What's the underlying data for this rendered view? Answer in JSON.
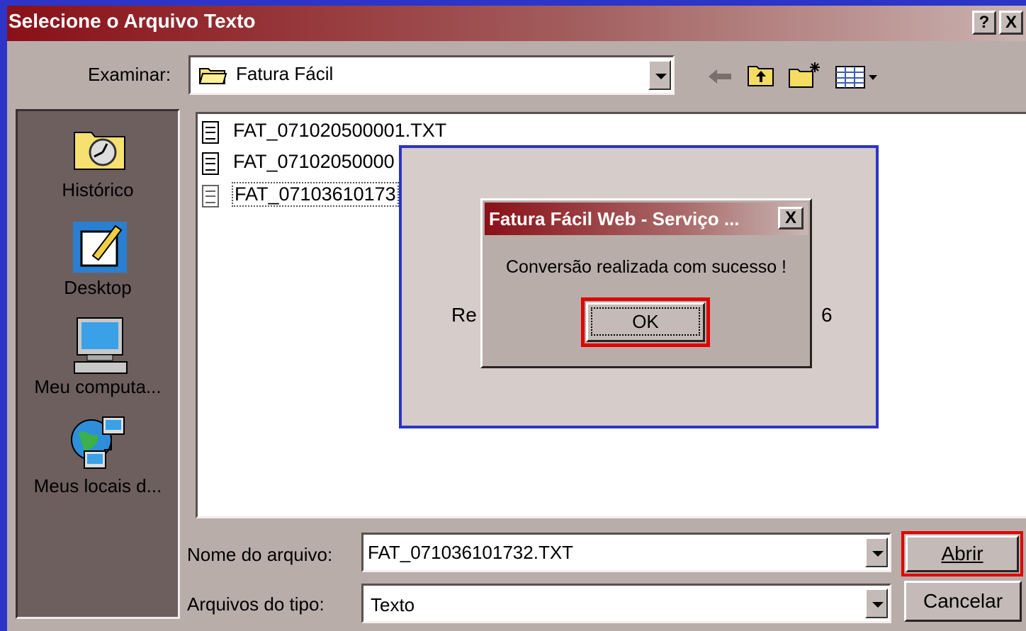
{
  "window": {
    "title": "Selecione o Arquivo Texto",
    "help_label": "?",
    "close_label": "X"
  },
  "toolbar": {
    "look_in_label": "Examinar:",
    "look_in_value": "Fatura Fácil"
  },
  "places": [
    {
      "label": "Histórico",
      "icon": "history-icon"
    },
    {
      "label": "Desktop",
      "icon": "desktop-icon"
    },
    {
      "label": "Meu computa...",
      "icon": "my-computer-icon"
    },
    {
      "label": "Meus locais d...",
      "icon": "network-places-icon"
    }
  ],
  "files": [
    {
      "name": "FAT_071020500001.TXT"
    },
    {
      "name": "FAT_07102050000"
    },
    {
      "name": "FAT_07103610173"
    }
  ],
  "form": {
    "filename_label": "Nome do arquivo:",
    "filename_value": "FAT_071036101732.TXT",
    "filetype_label": "Arquivos do tipo:",
    "filetype_value": "Texto",
    "open_label": "Abrir",
    "cancel_label": "Cancelar"
  },
  "overlay": {
    "left_text": "Re",
    "right_text": "6"
  },
  "dialog": {
    "title": "Fatura Fácil Web - Serviço ...",
    "close_label": "X",
    "message": "Conversão realizada com sucesso !",
    "ok_label": "OK"
  },
  "colors": {
    "highlight_red": "#e00000",
    "frame_blue": "#2c35c8",
    "title_maroon": "#8a1018"
  }
}
